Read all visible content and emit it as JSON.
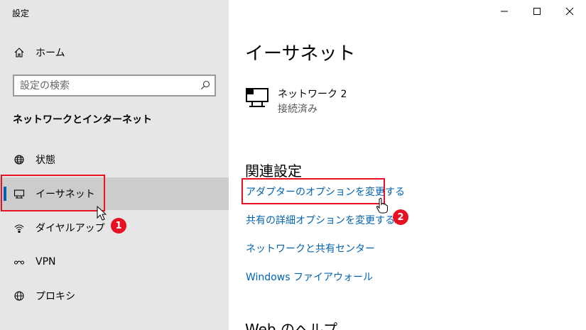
{
  "window": {
    "title": "設定"
  },
  "sidebar": {
    "home_label": "ホーム",
    "search_placeholder": "設定の検索",
    "section_title": "ネットワークとインターネット",
    "items": [
      {
        "label": "状態",
        "icon": "globe-icon"
      },
      {
        "label": "イーサネット",
        "icon": "ethernet-icon",
        "selected": true
      },
      {
        "label": "ダイヤルアップ",
        "icon": "dialup-icon"
      },
      {
        "label": "VPN",
        "icon": "vpn-icon"
      },
      {
        "label": "プロキシ",
        "icon": "globe-icon"
      }
    ]
  },
  "main": {
    "title": "イーサネット",
    "network": {
      "name": "ネットワーク 2",
      "status": "接続済み"
    },
    "related_title": "関連設定",
    "links": [
      "アダプターのオプションを変更する",
      "共有の詳細オプションを変更する",
      "ネットワークと共有センター",
      "Windows ファイアウォール"
    ],
    "help_title": "Web のヘルプ"
  },
  "annotations": {
    "badge1": "1",
    "badge2": "2",
    "highlight_color": "#e81123"
  },
  "colors": {
    "accent": "#0063b1",
    "link": "#0063b1",
    "sidebar_bg": "#e6e6e6",
    "selected_bg": "#cccccc"
  }
}
